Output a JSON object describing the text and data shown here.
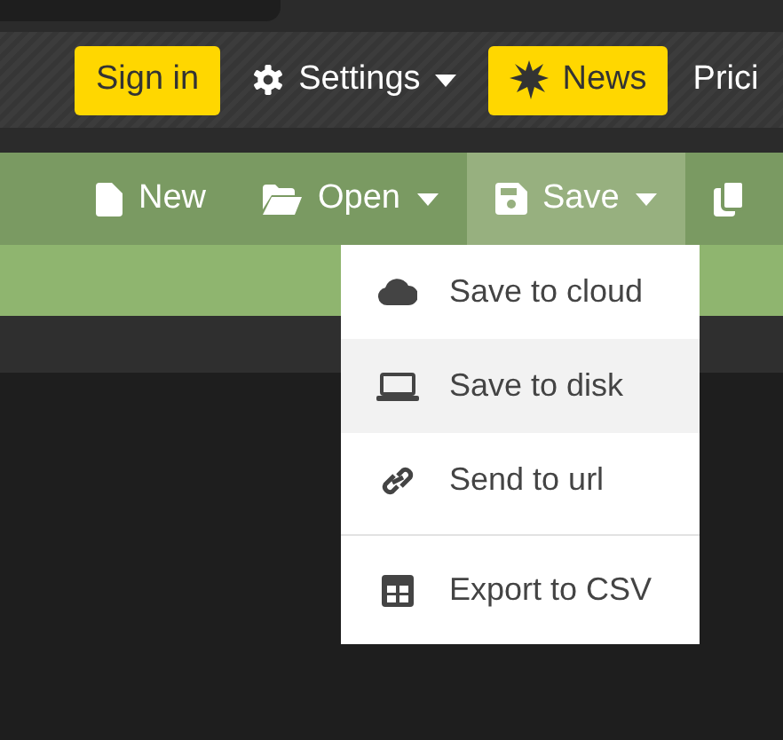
{
  "header": {
    "items": [
      {
        "kind": "button",
        "label": "Sign in"
      },
      {
        "kind": "menu",
        "label": "Settings"
      },
      {
        "kind": "button",
        "label": "News"
      },
      {
        "kind": "link",
        "label": "Prici"
      }
    ]
  },
  "toolbar": {
    "items": [
      {
        "label": "New",
        "dropdown": false,
        "selected": false
      },
      {
        "label": "Open",
        "dropdown": true,
        "selected": false
      },
      {
        "label": "Save",
        "dropdown": true,
        "selected": true
      },
      {
        "dropdown": false,
        "selected": false
      }
    ]
  },
  "menu": {
    "items": [
      {
        "label": "Save to cloud",
        "highlighted": false,
        "separator_before": false
      },
      {
        "label": "Save to disk",
        "highlighted": true,
        "separator_before": false
      },
      {
        "label": "Send to url",
        "highlighted": false,
        "separator_before": false
      },
      {
        "label": "Export to CSV",
        "highlighted": false,
        "separator_before": true
      }
    ]
  }
}
